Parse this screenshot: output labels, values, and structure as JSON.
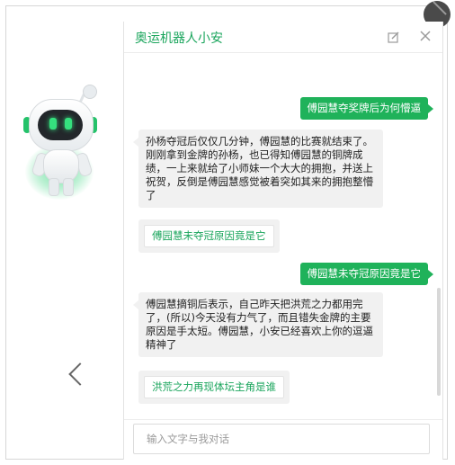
{
  "chat": {
    "title": "奥运机器人小安",
    "input_placeholder": "输入文字与我对话",
    "messages": [
      {
        "role": "user",
        "text": "傅园慧夺奖牌后为何懵逼"
      },
      {
        "role": "bot",
        "text": "孙杨夺冠后仅仅几分钟，傅园慧的比赛就结束了。刚刚拿到金牌的孙杨，也已得知傅园慧的铜牌成绩，一上来就给了小师妹一个大大的拥抱，并送上祝贺，反倒是傅园慧感觉被着突如其来的拥抱整懵了"
      },
      {
        "role": "suggestion",
        "text": "傅园慧未夺冠原因竟是它"
      },
      {
        "role": "user",
        "text": "傅园慧未夺冠原因竟是它"
      },
      {
        "role": "bot",
        "text": "傅园慧摘铜后表示，自己昨天把洪荒之力都用完了，(所以)今天没有力气了，而且错失金牌的主要原因是手太短。傅园慧，小安已经喜欢上你的逗逼精神了"
      },
      {
        "role": "suggestion",
        "text": "洪荒之力再现体坛主角是谁"
      }
    ]
  },
  "colors": {
    "accent": "#1fb25a",
    "title": "#1aa55c",
    "bot_bubble": "#f1f1f1"
  },
  "icons": {
    "edit": "edit-icon",
    "close": "close-icon",
    "prev": "chevron-left-icon",
    "next": "chevron-right-icon"
  }
}
